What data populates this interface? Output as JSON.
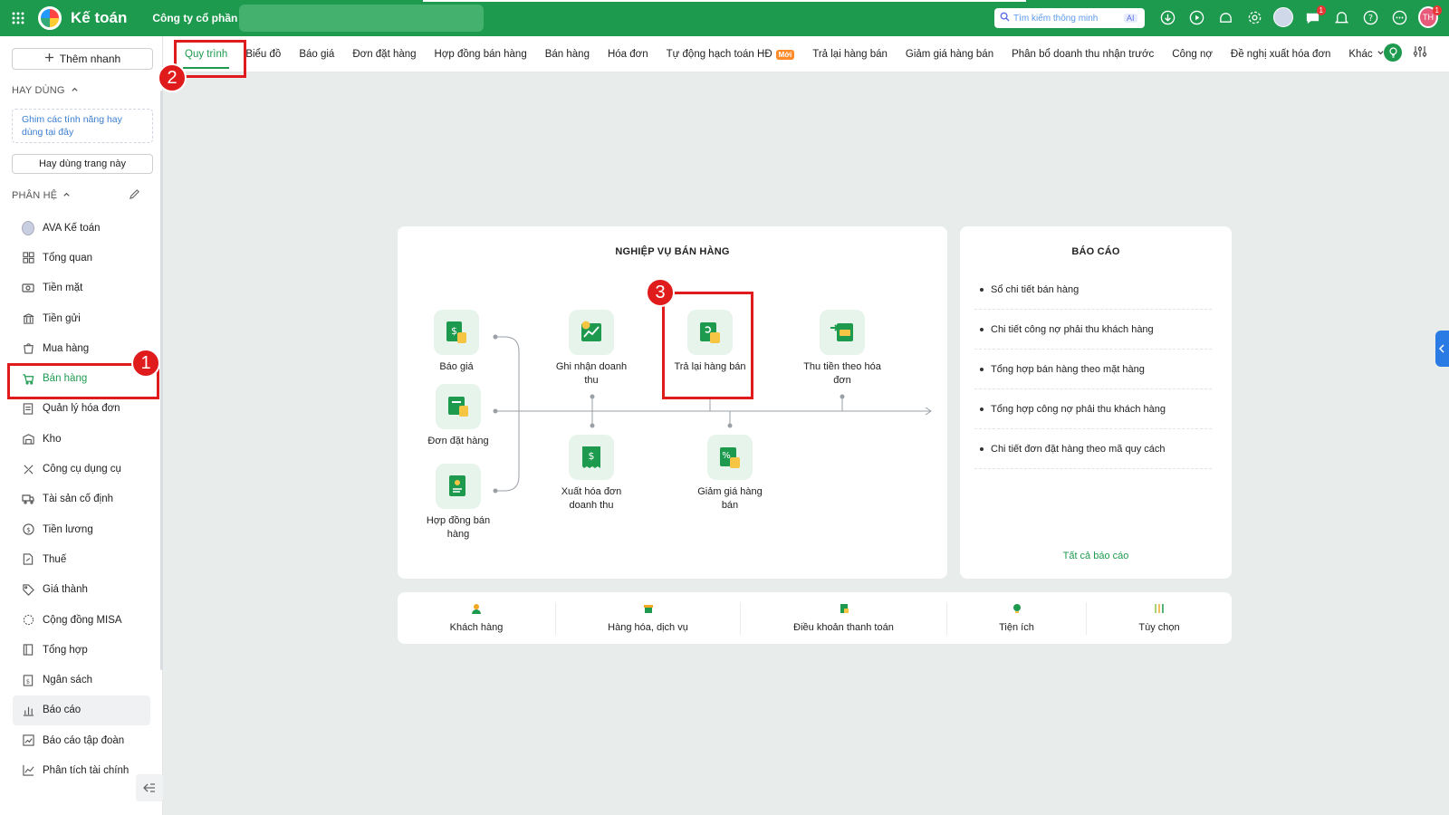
{
  "topbar": {
    "app_title": "Kế toán",
    "company": "Công ty cổ phần",
    "search_placeholder": "Tìm kiếm thông minh",
    "ai_label": "AI",
    "chat_badge": "1",
    "avatar_badge": "1",
    "user_initials": "TH"
  },
  "sidebar": {
    "add_button": "Thêm nhanh",
    "favorites_title": "HAY DÙNG",
    "pin_hint": "Ghim các tính năng hay dùng tại đây",
    "favorite_page_button": "Hay dùng trang này",
    "modules_title": "PHÂN HỆ",
    "items": [
      {
        "label": "AVA Kế toán",
        "icon": "ava-avatar-icon"
      },
      {
        "label": "Tổng quan",
        "icon": "dashboard-icon"
      },
      {
        "label": "Tiền mặt",
        "icon": "cash-icon"
      },
      {
        "label": "Tiền gửi",
        "icon": "bank-icon"
      },
      {
        "label": "Mua hàng",
        "icon": "shopping-bag-icon"
      },
      {
        "label": "Bán hàng",
        "icon": "cart-icon"
      },
      {
        "label": "Quản lý hóa đơn",
        "icon": "invoice-icon"
      },
      {
        "label": "Kho",
        "icon": "warehouse-icon"
      },
      {
        "label": "Công cụ dụng cụ",
        "icon": "tools-icon"
      },
      {
        "label": "Tài sản cố định",
        "icon": "truck-icon"
      },
      {
        "label": "Tiền lương",
        "icon": "salary-icon"
      },
      {
        "label": "Thuế",
        "icon": "tax-icon"
      },
      {
        "label": "Giá thành",
        "icon": "price-tag-icon"
      },
      {
        "label": "Cộng đồng MISA",
        "icon": "community-icon"
      },
      {
        "label": "Tổng hợp",
        "icon": "summary-icon"
      },
      {
        "label": "Ngân sách",
        "icon": "budget-icon"
      },
      {
        "label": "Báo cáo",
        "icon": "report-chart-icon"
      },
      {
        "label": "Báo cáo tập đoàn",
        "icon": "group-report-icon"
      },
      {
        "label": "Phân tích tài chính",
        "icon": "analysis-icon"
      }
    ]
  },
  "tabs": [
    {
      "label": "Quy trình"
    },
    {
      "label": "Biểu đồ"
    },
    {
      "label": "Báo giá"
    },
    {
      "label": "Đơn đặt hàng"
    },
    {
      "label": "Hợp đồng bán hàng"
    },
    {
      "label": "Bán hàng"
    },
    {
      "label": "Hóa đơn"
    },
    {
      "label": "Tự động hạch toán HĐ",
      "badge": "Mới"
    },
    {
      "label": "Trả lại hàng bán"
    },
    {
      "label": "Giảm giá hàng bán"
    },
    {
      "label": "Phân bổ doanh thu nhận trước"
    },
    {
      "label": "Công nợ"
    },
    {
      "label": "Đề nghị xuất hóa đơn"
    },
    {
      "label": "Khác"
    }
  ],
  "process": {
    "title": "NGHIỆP VỤ BÁN HÀNG",
    "items": {
      "quote": "Báo giá",
      "order": "Đơn đặt hàng",
      "contract": "Hợp đồng bán hàng",
      "revenue": "Ghi nhận doanh thu",
      "invoice": "Xuất hóa đơn doanh thu",
      "return": "Trả lại hàng bán",
      "discount": "Giảm giá hàng bán",
      "collect": "Thu tiền theo hóa đơn"
    }
  },
  "reports": {
    "title": "BÁO CÁO",
    "items": [
      "Sổ chi tiết bán hàng",
      "Chi tiết công nợ phải thu khách hàng",
      "Tổng hợp bán hàng theo mặt hàng",
      "Tổng hợp công nợ phải thu khách hàng",
      "Chi tiết đơn đặt hàng theo mã quy cách"
    ],
    "all_link": "Tất cả báo cáo"
  },
  "bottom": [
    {
      "label": "Khách hàng",
      "color": "#f5a623"
    },
    {
      "label": "Hàng hóa, dịch vụ",
      "color": "#f5a623"
    },
    {
      "label": "Điều khoản thanh toán",
      "color": "#1e9a4f"
    },
    {
      "label": "Tiện ích",
      "color": "#1e9a4f"
    },
    {
      "label": "Tùy chọn",
      "color": "#8ac43f"
    }
  ],
  "annotations": [
    "1",
    "2",
    "3"
  ],
  "colors": {
    "brand": "#1e9a4f",
    "annotation": "#e01b1b",
    "icon_bg": "#e6f4ec"
  }
}
